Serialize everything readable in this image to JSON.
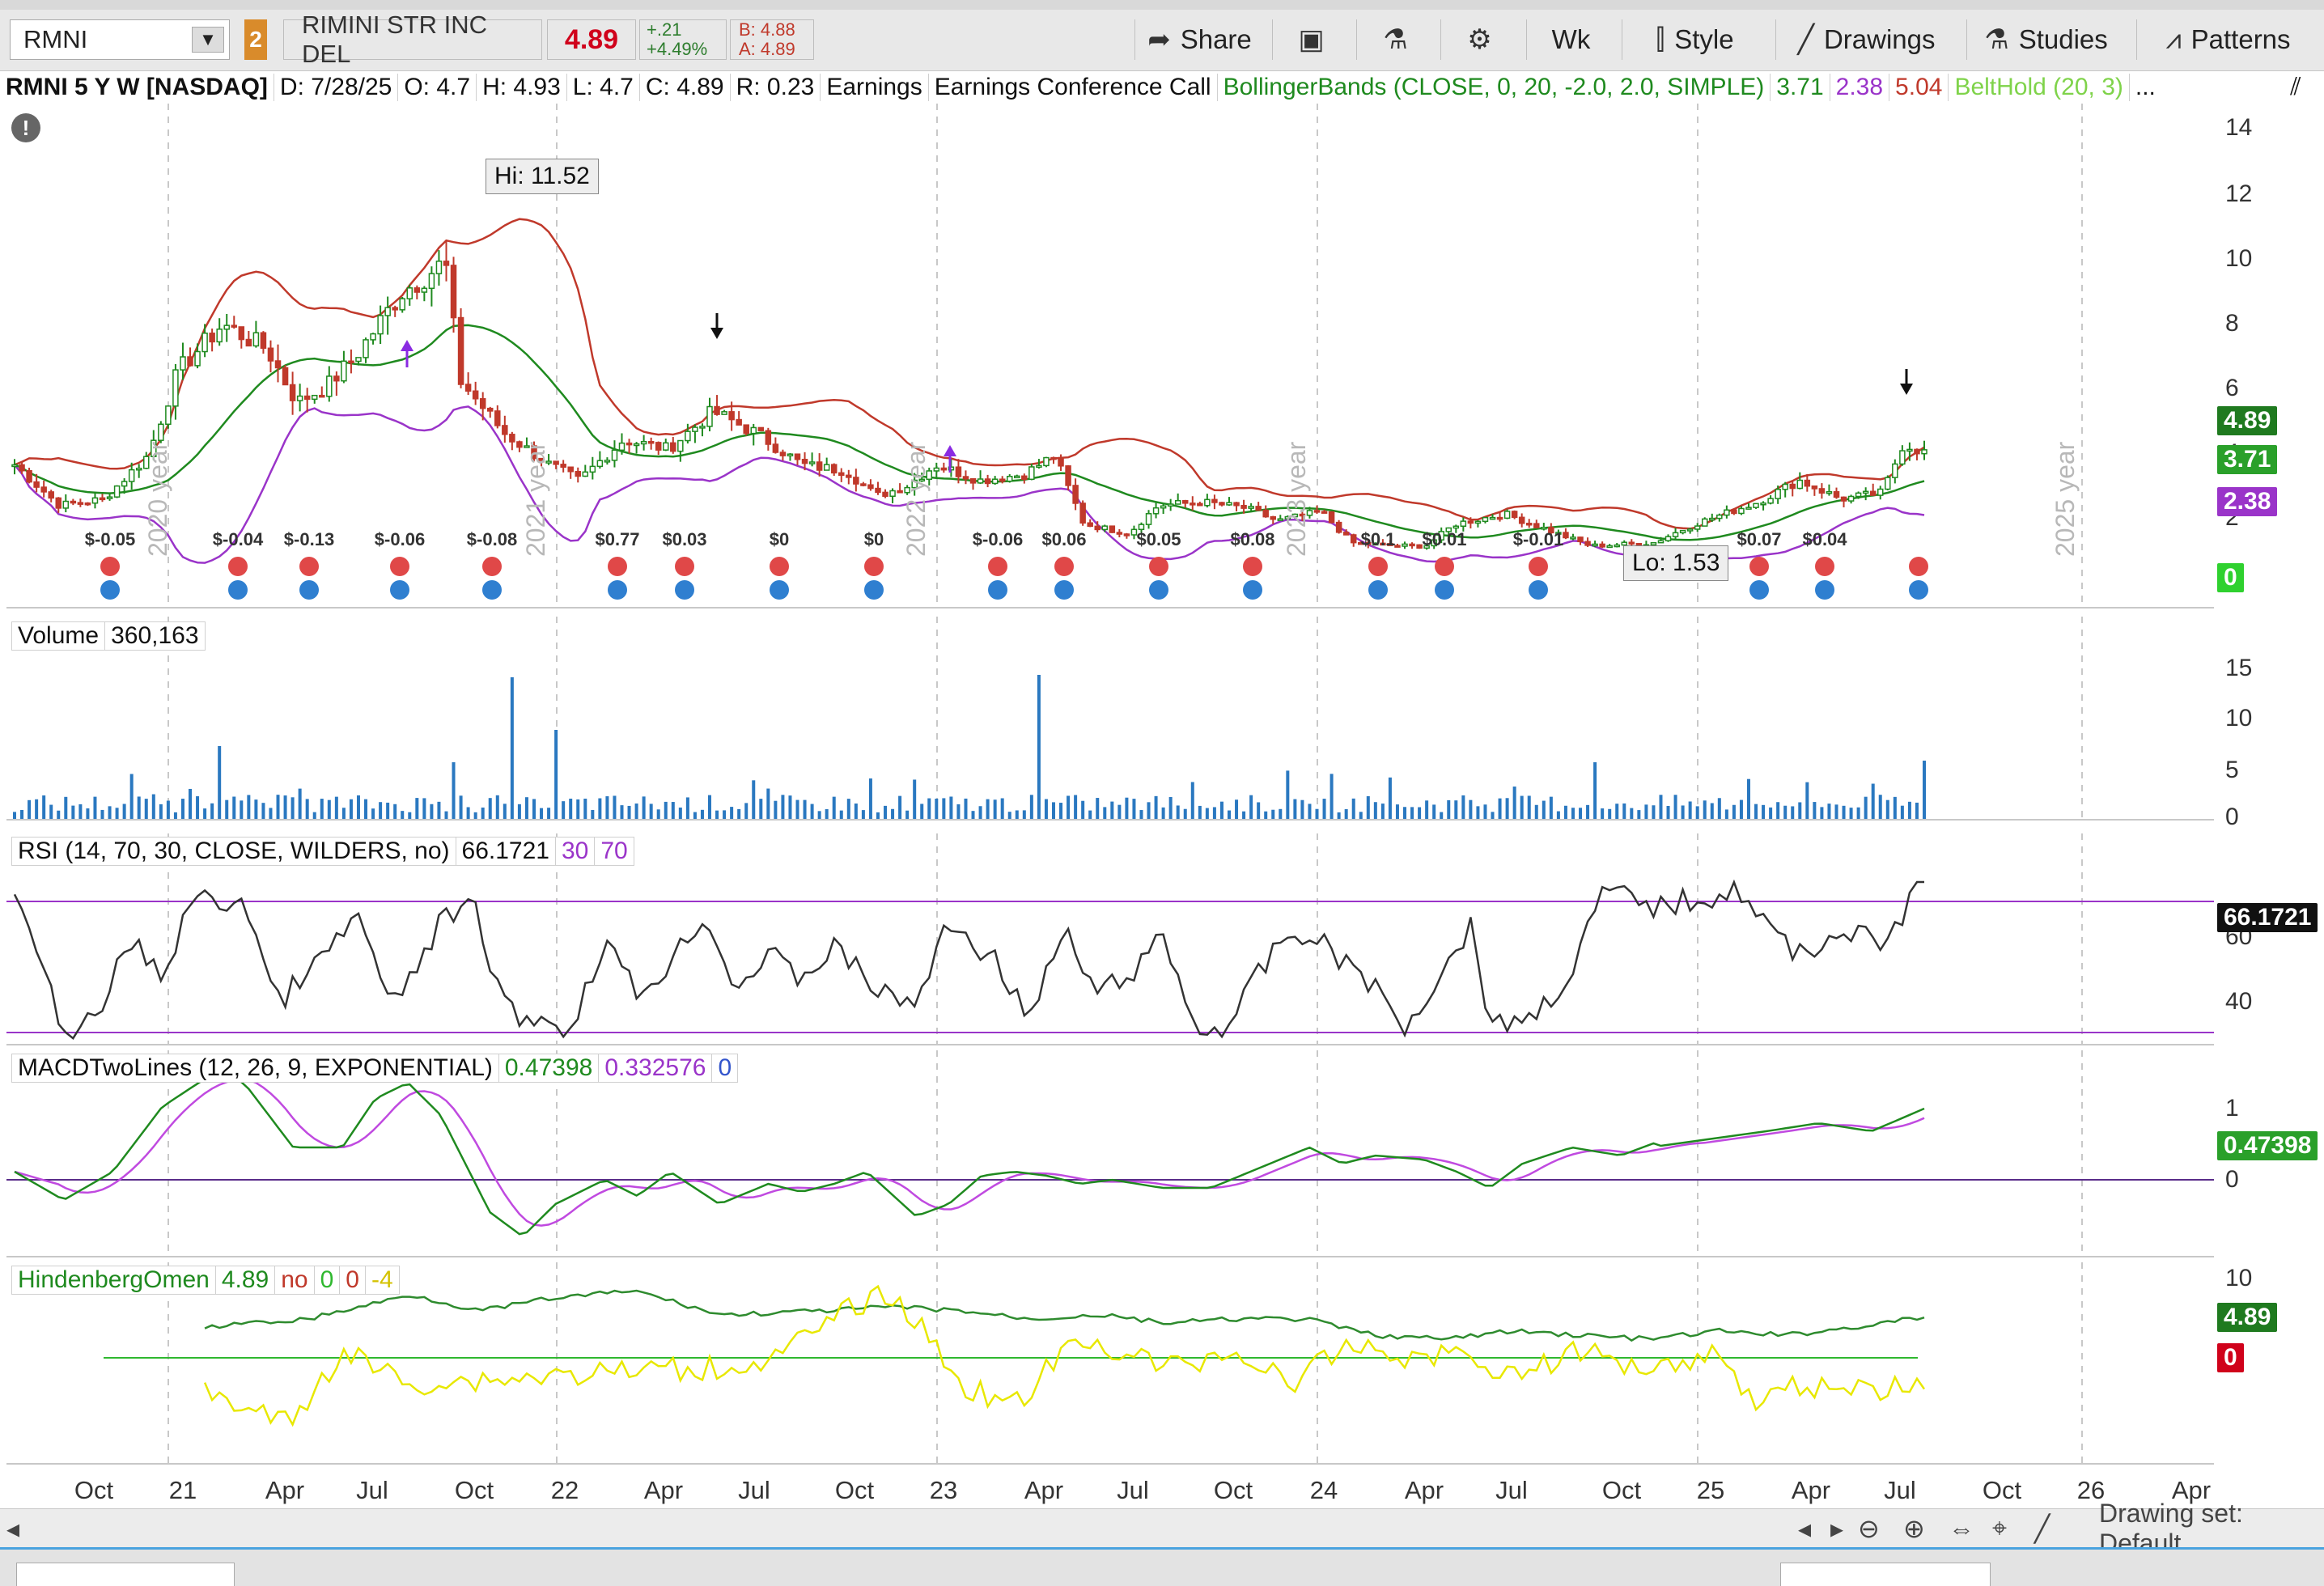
{
  "toolbar": {
    "symbol": "RMNI",
    "link_badge": "2",
    "company": "RIMINI STR INC DEL",
    "last": "4.89",
    "change_abs": "+.21",
    "change_pct": "+4.49%",
    "bid": "B: 4.88",
    "ask": "A: 4.89",
    "share_label": "Share",
    "period_label": "Wk",
    "style_label": "Style",
    "drawings_label": "Drawings",
    "studies_label": "Studies",
    "patterns_label": "Patterns"
  },
  "header": {
    "title": "RMNI 5 Y W [NASDAQ]",
    "date": "D: 7/28/25",
    "open": "O: 4.7",
    "high": "H: 4.93",
    "low": "L: 4.7",
    "close": "C: 4.89",
    "range": "R: 0.23",
    "earnings": "Earnings",
    "earnings_call": "Earnings Conference Call",
    "bb_label": "BollingerBands (CLOSE, 0, 20, -2.0, 2.0, SIMPLE)",
    "bb_mid": "3.71",
    "bb_low": "2.38",
    "bb_up": "5.04",
    "belthold": "BeltHold (20, 3)",
    "more": "..."
  },
  "price_pane": {
    "hi_label": "Hi: 11.52",
    "lo_label": "Lo: 1.53",
    "year_labels": [
      "2020 year",
      "2021 year",
      "2022 year",
      "2023 year",
      "2025 year"
    ],
    "eps": [
      "$-0.05",
      "$-0.04",
      "$-0.13",
      "$-0.06",
      "$-0.08",
      "$0.77",
      "$0.03",
      "$0",
      "$0",
      "$-0.06",
      "$0.06",
      "$0.05",
      "$0.08",
      "$0.1",
      "$0.01",
      "$-0.01",
      "$0.07",
      "$0.04"
    ],
    "axis": [
      "14",
      "12",
      "10",
      "8",
      "6",
      "4",
      "2",
      "0"
    ],
    "flags": {
      "price": "4.89",
      "bb_mid": "3.71",
      "bb_low": "2.38",
      "zero": "0"
    }
  },
  "volume_pane": {
    "label": "Volume",
    "value": "360,163",
    "axis": [
      "15",
      "10",
      "5",
      "0"
    ]
  },
  "rsi_pane": {
    "label": "RSI (14, 70, 30, CLOSE, WILDERS, no)",
    "value": "66.1721",
    "ob": "30",
    "os": "70",
    "axis": [
      "60",
      "40"
    ],
    "flag": "66.1721"
  },
  "macd_pane": {
    "label": "MACDTwoLines (12, 26, 9, EXPONENTIAL)",
    "value": "0.47398",
    "avg": "0.332576",
    "diff": "0",
    "axis": [
      "1",
      "0"
    ],
    "flag": "0.47398"
  },
  "hind_pane": {
    "label": "HindenbergOmen",
    "value": "4.89",
    "signal": "no",
    "v2": "0",
    "v3": "0",
    "v4": "-4",
    "axis": [
      "10"
    ],
    "flag_price": "4.89",
    "flag_zero": "0"
  },
  "xaxis": [
    "Oct",
    "21",
    "Apr",
    "Jul",
    "Oct",
    "22",
    "Apr",
    "Jul",
    "Oct",
    "23",
    "Apr",
    "Jul",
    "Oct",
    "24",
    "Apr",
    "Jul",
    "Oct",
    "25",
    "Apr",
    "Jul",
    "Oct",
    "26",
    "Apr"
  ],
  "bottom": {
    "drawing_set": "Drawing set: Default"
  },
  "colors": {
    "up": "#1f8a1f",
    "down": "#c0392b",
    "bb_upper": "#c0392b",
    "bb_mid": "#1f8a1f",
    "bb_lower": "#9a34c9",
    "rsi_line": "#9a34c9",
    "hind_signal": "#e8e800",
    "volume": "#2a78c0"
  }
}
